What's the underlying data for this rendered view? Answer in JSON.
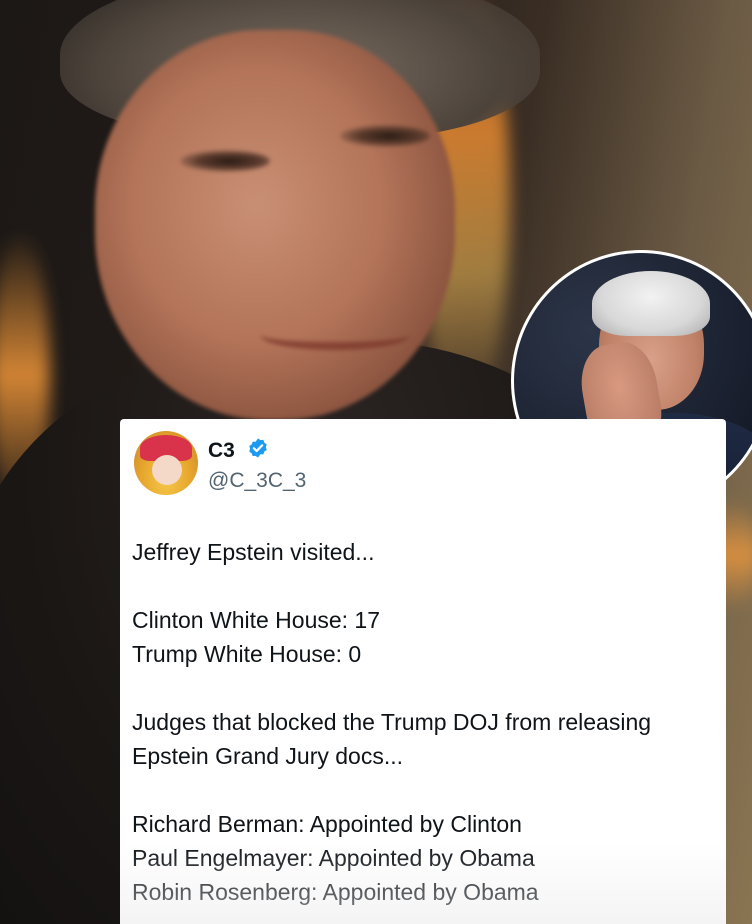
{
  "tweet": {
    "display_name": "C3",
    "handle": "@C_3C_3",
    "verified": true,
    "verified_icon": "verified-badge-icon",
    "lines": [
      "Jeffrey Epstein visited...",
      "",
      "Clinton White House: 17",
      "Trump White House: 0",
      "",
      "Judges that blocked the Trump DOJ from releasing Epstein Grand Jury docs...",
      "",
      "Richard Berman: Appointed by Clinton",
      "Paul Engelmayer: Appointed by Obama",
      "Robin Rosenberg: Appointed by Obama"
    ]
  },
  "colors": {
    "accent_verified": "#1d9bf0",
    "text_primary": "#0f1419",
    "text_secondary": "#536471",
    "card_background": "#ffffff"
  }
}
